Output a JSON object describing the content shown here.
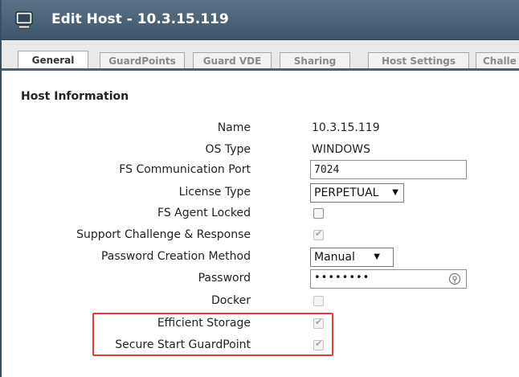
{
  "window": {
    "title": "Edit Host - 10.3.15.119",
    "icon": "monitor-icon"
  },
  "tabs": [
    {
      "label": "General",
      "active": true
    },
    {
      "label": "GuardPoints",
      "active": false
    },
    {
      "label": "Guard VDE",
      "active": false
    },
    {
      "label": "Sharing",
      "active": false
    },
    {
      "label": "Host Settings",
      "active": false
    },
    {
      "label": "Challe",
      "active": false
    }
  ],
  "section": {
    "title": "Host Information"
  },
  "fields": {
    "name": {
      "label": "Name",
      "value": "10.3.15.119"
    },
    "os_type": {
      "label": "OS Type",
      "value": "WINDOWS"
    },
    "fs_port": {
      "label": "FS Communication Port",
      "value": "7024"
    },
    "license_type": {
      "label": "License Type",
      "value": "PERPETUAL"
    },
    "fs_agent_locked": {
      "label": "FS Agent Locked",
      "checked": false
    },
    "support_challenge": {
      "label": "Support Challenge & Response",
      "checked": true,
      "disabled": true
    },
    "pw_creation": {
      "label": "Password Creation Method",
      "value": "Manual"
    },
    "password": {
      "label": "Password",
      "value": "••••••••"
    },
    "docker": {
      "label": "Docker",
      "checked": false,
      "disabled": true
    },
    "efficient_storage": {
      "label": "Efficient Storage",
      "checked": true,
      "disabled": true
    },
    "secure_start": {
      "label": "Secure Start GuardPoint",
      "checked": true,
      "disabled": true
    }
  },
  "colors": {
    "titlebar": "#4a6177",
    "highlight": "#e23b3b"
  }
}
